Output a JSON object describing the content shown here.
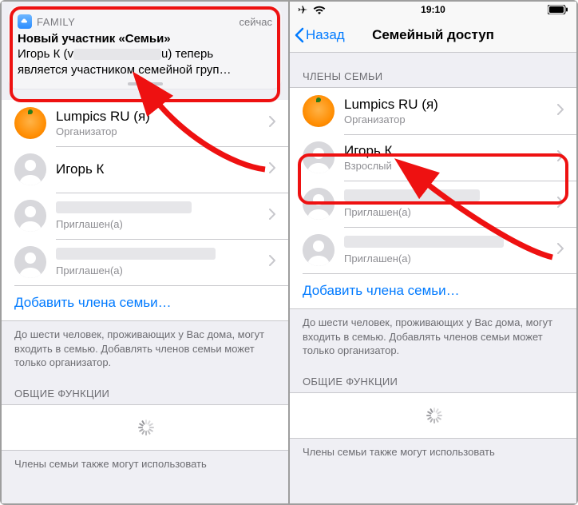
{
  "left": {
    "notification": {
      "app_label": "FAMILY",
      "time": "сейчас",
      "title": "Новый участник «Семьи»",
      "body_line1": "Игорь К (v",
      "body_line2": "u) теперь",
      "body_line3": "является участником семейной груп…"
    },
    "members": {
      "m0": {
        "name": "Lumpics RU (я)",
        "role": "Организатор"
      },
      "m1": {
        "name": "Игорь К",
        "role": ""
      },
      "m2": {
        "name": "",
        "role": "Приглашен(а)"
      },
      "m3": {
        "name": "",
        "role": "Приглашен(а)"
      }
    },
    "add_member": "Добавить члена семьи…",
    "footer1": "До шести человек, проживающих у Вас дома, могут входить в семью. Добавлять членов семьи может только организатор.",
    "section2": "ОБЩИЕ ФУНКЦИИ",
    "footer2": "Члены семьи также могут использовать"
  },
  "right": {
    "status_time": "19:10",
    "back": "Назад",
    "title": "Семейный доступ",
    "section1": "ЧЛЕНЫ СЕМЬИ",
    "members": {
      "m0": {
        "name": "Lumpics RU (я)",
        "role": "Организатор"
      },
      "m1": {
        "name": "Игорь К",
        "role": "Взрослый"
      },
      "m2": {
        "name": "",
        "role": "Приглашен(а)"
      },
      "m3": {
        "name": "",
        "role": "Приглашен(а)"
      }
    },
    "add_member": "Добавить члена семьи…",
    "footer1": "До шести человек, проживающих у Вас дома, могут входить в семью. Добавлять членов семьи может только организатор.",
    "section2": "ОБЩИЕ ФУНКЦИИ",
    "footer2": "Члены семьи также могут использовать"
  }
}
